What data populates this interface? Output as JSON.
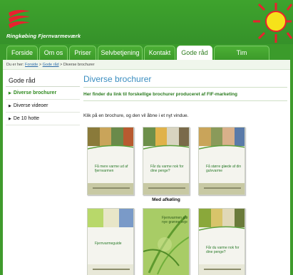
{
  "header": {
    "site_name": "Ringkøbing Fjernvarmeværk",
    "brand_color": "#3ea32d",
    "accent_color": "#e8212e"
  },
  "nav": {
    "tabs": [
      {
        "label": "Forside"
      },
      {
        "label": "Om os"
      },
      {
        "label": "Priser"
      },
      {
        "label": "Selvbetjening"
      },
      {
        "label": "Kontakt"
      },
      {
        "label": "Gode råd",
        "active": true
      },
      {
        "label": "Tim Kraftvarmeværk"
      }
    ]
  },
  "breadcrumb": {
    "prefix": "Du er her:",
    "items": [
      "Forside",
      "Gode råd"
    ],
    "current": "Diverse brochurer",
    "separator": ">"
  },
  "sidebar": {
    "title": "Gode råd",
    "items": [
      {
        "label": "Diverse brochurer",
        "active": true
      },
      {
        "label": "Diverse videoer"
      },
      {
        "label": "De 10 hotte"
      }
    ]
  },
  "main": {
    "title": "Diverse brochurer",
    "lead": "Her finder du link til forskellige brochurer produceret af FIF-marketing",
    "instruction": "Klik på en brochure, og den vil åbne i et nyt vindue."
  },
  "brochures": [
    {
      "title": "Få mere varme ud af fjernvarmen"
    },
    {
      "title": "Får du varme nok for dine penge?"
    },
    {
      "title": "Få større glæde af din gulvvarme"
    },
    {
      "title": "Fjernvarmeguide"
    },
    {
      "title": "Fjernvarmen går nye grønne veje"
    },
    {
      "title": "Får du varme nok for dine penge?"
    }
  ],
  "caption": "Med afkøling"
}
